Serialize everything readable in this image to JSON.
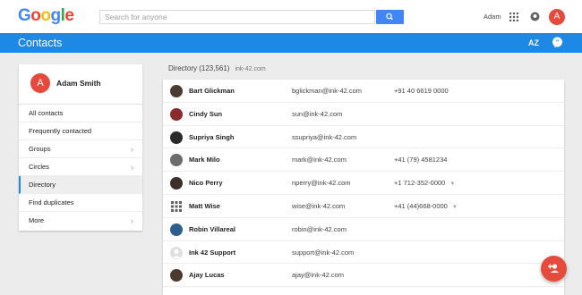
{
  "gbar": {
    "logo": [
      "G",
      "o",
      "o",
      "g",
      "l",
      "e"
    ],
    "search_placeholder": "Search for anyone",
    "user_name": "Adam",
    "avatar_initial": "A"
  },
  "appbar": {
    "title": "Contacts",
    "sort_label": "AZ"
  },
  "sidebar": {
    "profile": {
      "initial": "A",
      "name": "Adam Smith"
    },
    "items": [
      {
        "label": "All contacts",
        "chevron": ""
      },
      {
        "label": "Frequently contacted",
        "chevron": ""
      },
      {
        "label": "Groups",
        "chevron": "›"
      },
      {
        "label": "Circles",
        "chevron": "›"
      },
      {
        "label": "Directory",
        "chevron": "",
        "active": true
      },
      {
        "label": "Find duplicates",
        "chevron": ""
      },
      {
        "label": "More",
        "chevron": "›"
      }
    ]
  },
  "directory": {
    "title": "Directory (123,561)",
    "domain": "ink-42.com"
  },
  "contacts": [
    {
      "name": "Bart Glickman",
      "email": "bglickman@ink-42.com",
      "phone": "+91 40 6619 0000",
      "more": "",
      "color": "#4a3b33"
    },
    {
      "name": "Cindy Sun",
      "email": "sun@ink-42.com",
      "phone": "",
      "more": "",
      "color": "#8b2a2a"
    },
    {
      "name": "Supriya Singh",
      "email": "ssupriya@ink-42.com",
      "phone": "",
      "more": "",
      "color": "#2b2b2b"
    },
    {
      "name": "Mark Milo",
      "email": "mark@ink-42.com",
      "phone": "+41 (79) 4581234",
      "more": "",
      "color": "#6d6d6d"
    },
    {
      "name": "Nico Perry",
      "email": "nperry@ink-42.com",
      "phone": "+1 712-352-0000",
      "more": "▼",
      "color": "#3a2f2a"
    },
    {
      "name": "Matt Wise",
      "email": "wise@ink-42.com",
      "phone": "+41 (44)668-0000",
      "more": "▼",
      "color": "#777777"
    },
    {
      "name": "Robin Villareal",
      "email": "robin@ink-42.com",
      "phone": "",
      "more": "",
      "color": "#2e5f8a"
    },
    {
      "name": "Ink 42 Support",
      "email": "support@ink-42.com",
      "phone": "",
      "more": "",
      "color": "#e0e0e0"
    },
    {
      "name": "Ajay Lucas",
      "email": "ajay@ink-42.com",
      "phone": "",
      "more": "",
      "color": "#4b3a30"
    }
  ],
  "colors": {
    "accent": "#1e88e5",
    "fab": "#e64a3c",
    "search_button": "#4285f4"
  }
}
